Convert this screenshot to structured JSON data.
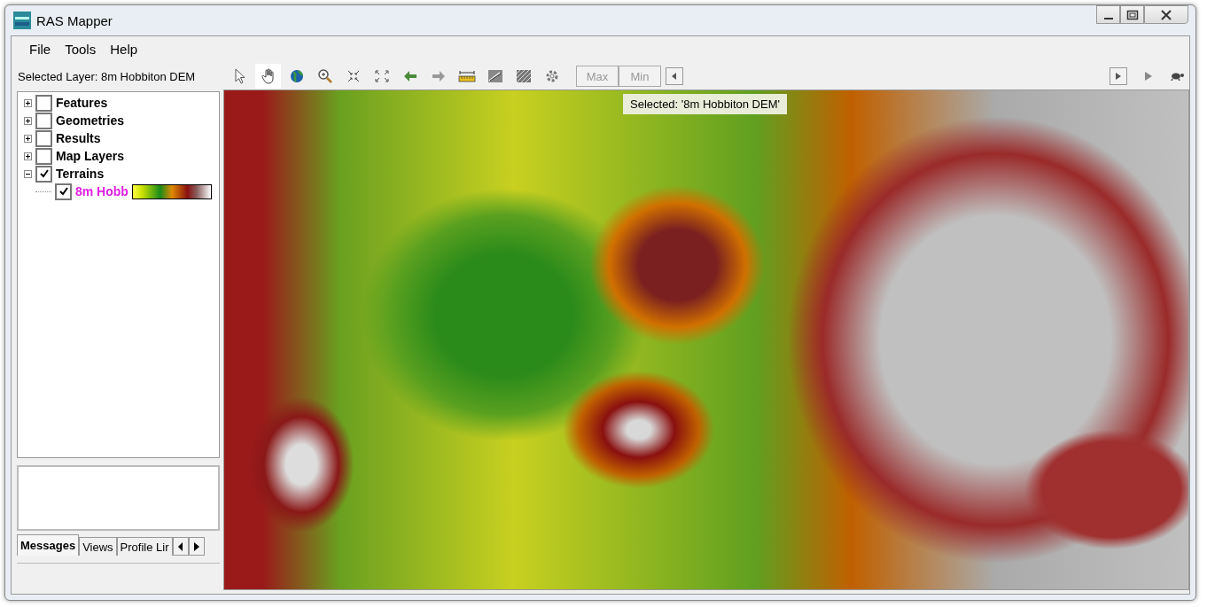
{
  "window": {
    "title": "RAS Mapper"
  },
  "menu": [
    "File",
    "Tools",
    "Help"
  ],
  "selected_layer": "Selected Layer: 8m Hobbiton DEM",
  "toolbar": [
    {
      "kind": "pointer",
      "selected": false
    },
    {
      "kind": "pan",
      "selected": true
    },
    {
      "kind": "globe",
      "selected": false
    },
    {
      "kind": "zoom",
      "selected": false
    },
    {
      "kind": "shrink",
      "selected": false
    },
    {
      "kind": "expand",
      "selected": false
    },
    {
      "kind": "back",
      "selected": false
    },
    {
      "kind": "forward",
      "selected": false
    },
    {
      "kind": "ruler",
      "selected": false
    },
    {
      "kind": "profile",
      "selected": false
    },
    {
      "kind": "hatch",
      "selected": false
    },
    {
      "kind": "gear",
      "selected": false
    }
  ],
  "range_buttons": [
    {
      "label": "Max",
      "disabled": true
    },
    {
      "label": "Min",
      "disabled": true
    }
  ],
  "tree": [
    {
      "label": "Features",
      "checked": false,
      "expanded": false
    },
    {
      "label": "Geometries",
      "checked": false,
      "expanded": false
    },
    {
      "label": "Results",
      "checked": false,
      "expanded": false
    },
    {
      "label": "Map Layers",
      "checked": false,
      "expanded": false
    },
    {
      "label": "Terrains",
      "checked": true,
      "expanded": true,
      "children": [
        {
          "label": "8m Hobb",
          "checked": true
        }
      ]
    }
  ],
  "tabs": [
    {
      "label": "Messages",
      "selected": true
    },
    {
      "label": "Views",
      "selected": false
    },
    {
      "label": "Profile Lir",
      "selected": false
    }
  ],
  "map": {
    "tooltip": "Selected: '8m Hobbiton DEM'"
  }
}
